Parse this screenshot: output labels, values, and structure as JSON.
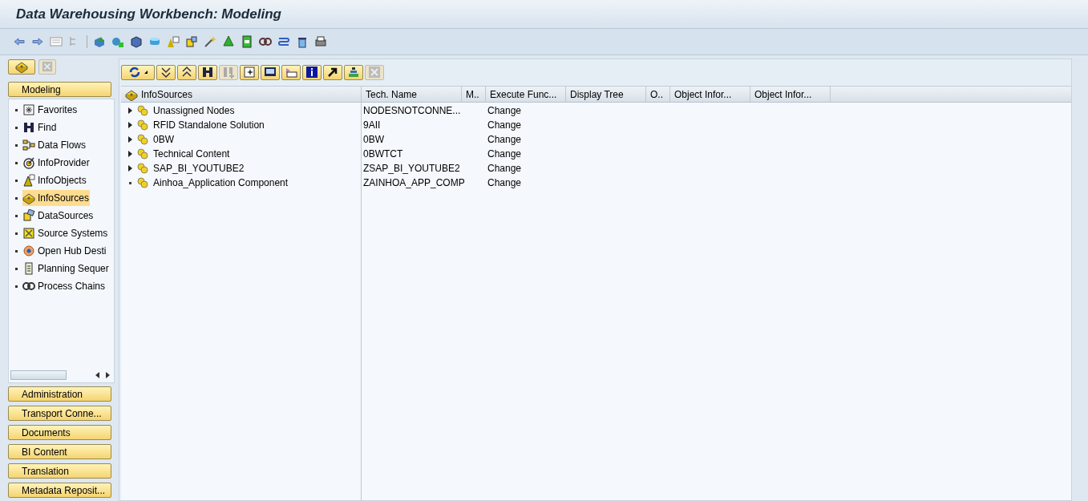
{
  "window": {
    "title": "Data Warehousing Workbench: Modeling"
  },
  "navigator": {
    "active_section": "Modeling",
    "items": [
      {
        "label": "Favorites",
        "selected": false
      },
      {
        "label": "Find",
        "selected": false
      },
      {
        "label": "Data Flows",
        "selected": false
      },
      {
        "label": "InfoProvider",
        "selected": false
      },
      {
        "label": "InfoObjects",
        "selected": false
      },
      {
        "label": "InfoSources",
        "selected": true
      },
      {
        "label": "DataSources",
        "selected": false
      },
      {
        "label": "Source Systems",
        "selected": false
      },
      {
        "label": "Open Hub Desti",
        "selected": false
      },
      {
        "label": "Planning Sequer",
        "selected": false
      },
      {
        "label": "Process Chains",
        "selected": false
      }
    ],
    "sections": [
      "Administration",
      "Transport Conne...",
      "Documents",
      "BI Content",
      "Translation",
      "Metadata Reposit..."
    ]
  },
  "tree": {
    "columns": [
      "InfoSources",
      "Tech. Name",
      "M..",
      "Execute Func...",
      "Display Tree",
      "O..",
      "Object Infor...",
      "Object Infor..."
    ],
    "rows": [
      {
        "name": "Unassigned Nodes",
        "tech_name": "NODESNOTCONNE...",
        "execute": "Change",
        "expandable": true
      },
      {
        "name": "RFID Standalone Solution",
        "tech_name": "9AII",
        "execute": "Change",
        "expandable": true
      },
      {
        "name": "0BW",
        "tech_name": "0BW",
        "execute": "Change",
        "expandable": true
      },
      {
        "name": "Technical Content",
        "tech_name": "0BWTCT",
        "execute": "Change",
        "expandable": true
      },
      {
        "name": "SAP_BI_YOUTUBE2",
        "tech_name": "ZSAP_BI_YOUTUBE2",
        "execute": "Change",
        "expandable": true
      },
      {
        "name": "Ainhoa_Application Component",
        "tech_name": "ZAINHOA_APP_COMP",
        "execute": "Change",
        "expandable": false
      }
    ]
  }
}
